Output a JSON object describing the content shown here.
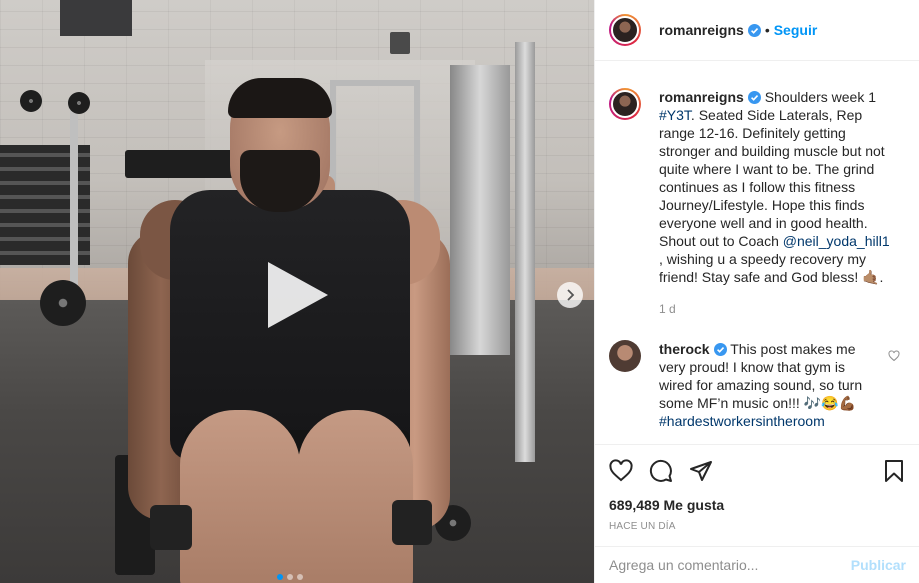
{
  "post": {
    "author": "romanreigns",
    "follow_label": "Seguir",
    "separator": "•",
    "caption_start": "Shoulders week 1 ",
    "hashtag": "#Y3T",
    "caption_mid": ". Seated Side Laterals, Rep range 12-16. Definitely getting stronger and building muscle but not quite where I want to be. The grind continues as I follow this fitness Journey/Lifestyle. Hope this finds everyone well and in good health. Shout out to Coach ",
    "mention": "@neil_yoda_hill1",
    "caption_end": " , wishing u a speedy recovery my friend! Stay safe and God bless! 🤙🏽.",
    "time_ago": "1 d"
  },
  "comment": {
    "author": "therock",
    "text": "This post makes me very proud! I know that gym is wired for amazing sound, so turn some MF’n music on!!! 🎶😂💪🏾 ",
    "hashtag": "#hardestworkersintheroom"
  },
  "stats": {
    "likes": "689,489 Me gusta",
    "date": "HACE UN DÍA"
  },
  "add_comment": {
    "placeholder": "Agrega un comentario...",
    "publish_label": "Publicar"
  },
  "carousel": {
    "slides": 3,
    "active_index": 0
  },
  "colors": {
    "link_blue": "#0095f6",
    "hashtag_blue": "#00376b",
    "muted": "#8e8e8e",
    "publish_disabled": "#b2dffc"
  },
  "icons": [
    "verified-icon",
    "play-icon",
    "chevron-right-icon",
    "heart-icon",
    "comment-icon",
    "share-icon",
    "bookmark-icon",
    "heart-small-icon"
  ]
}
